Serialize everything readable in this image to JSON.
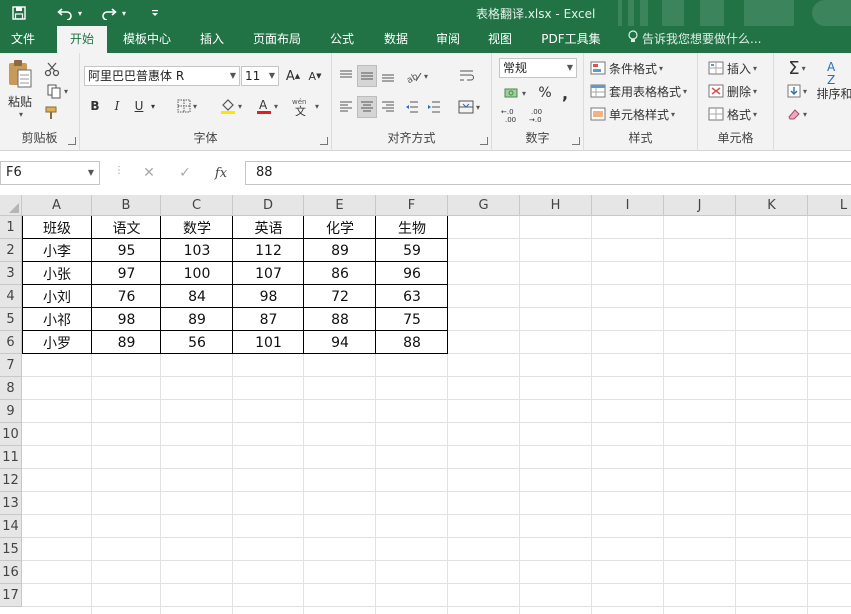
{
  "titlebar": {
    "title": "表格翻译.xlsx - Excel",
    "save_icon": "save-icon",
    "undo_icon": "undo-icon",
    "redo_icon": "redo-icon"
  },
  "tabs": [
    {
      "label": "文件"
    },
    {
      "label": "开始"
    },
    {
      "label": "模板中心"
    },
    {
      "label": "插入"
    },
    {
      "label": "页面布局"
    },
    {
      "label": "公式"
    },
    {
      "label": "数据"
    },
    {
      "label": "审阅"
    },
    {
      "label": "视图"
    },
    {
      "label": "PDF工具集"
    }
  ],
  "tell_me": "告诉我您想要做什么...",
  "ribbon": {
    "clipboard": {
      "paste_label": "粘贴",
      "group_label": "剪贴板"
    },
    "font": {
      "font_name": "阿里巴巴普惠体 R",
      "font_size": "11",
      "bold": "B",
      "italic": "I",
      "underline": "U",
      "group_label": "字体"
    },
    "alignment": {
      "group_label": "对齐方式"
    },
    "number": {
      "format": "常规",
      "percent": "%",
      "comma": ",",
      "group_label": "数字"
    },
    "styles": {
      "conditional": "条件格式",
      "table_format": "套用表格格式",
      "cell_styles": "单元格样式",
      "group_label": "样式"
    },
    "cells": {
      "insert": "插入",
      "delete": "删除",
      "format": "格式",
      "group_label": "单元格"
    },
    "editing": {
      "sort_filter": "排序和"
    }
  },
  "formula_bar": {
    "name_box": "F6",
    "formula": "88",
    "fx_label": "fx"
  },
  "columns": [
    "A",
    "B",
    "C",
    "D",
    "E",
    "F",
    "G",
    "H",
    "I",
    "J",
    "K",
    "L"
  ],
  "rows": [
    "1",
    "2",
    "3",
    "4",
    "5",
    "6",
    "7",
    "8",
    "9",
    "10",
    "11",
    "12",
    "13",
    "14",
    "15",
    "16",
    "17"
  ],
  "table": {
    "header": [
      "班级",
      "语文",
      "数学",
      "英语",
      "化学",
      "生物"
    ],
    "rows": [
      [
        "小李",
        "95",
        "103",
        "112",
        "89",
        "59"
      ],
      [
        "小张",
        "97",
        "100",
        "107",
        "86",
        "96"
      ],
      [
        "小刘",
        "76",
        "84",
        "98",
        "72",
        "63"
      ],
      [
        "小祁",
        "98",
        "89",
        "87",
        "88",
        "75"
      ],
      [
        "小罗",
        "89",
        "56",
        "101",
        "94",
        "88"
      ]
    ]
  }
}
